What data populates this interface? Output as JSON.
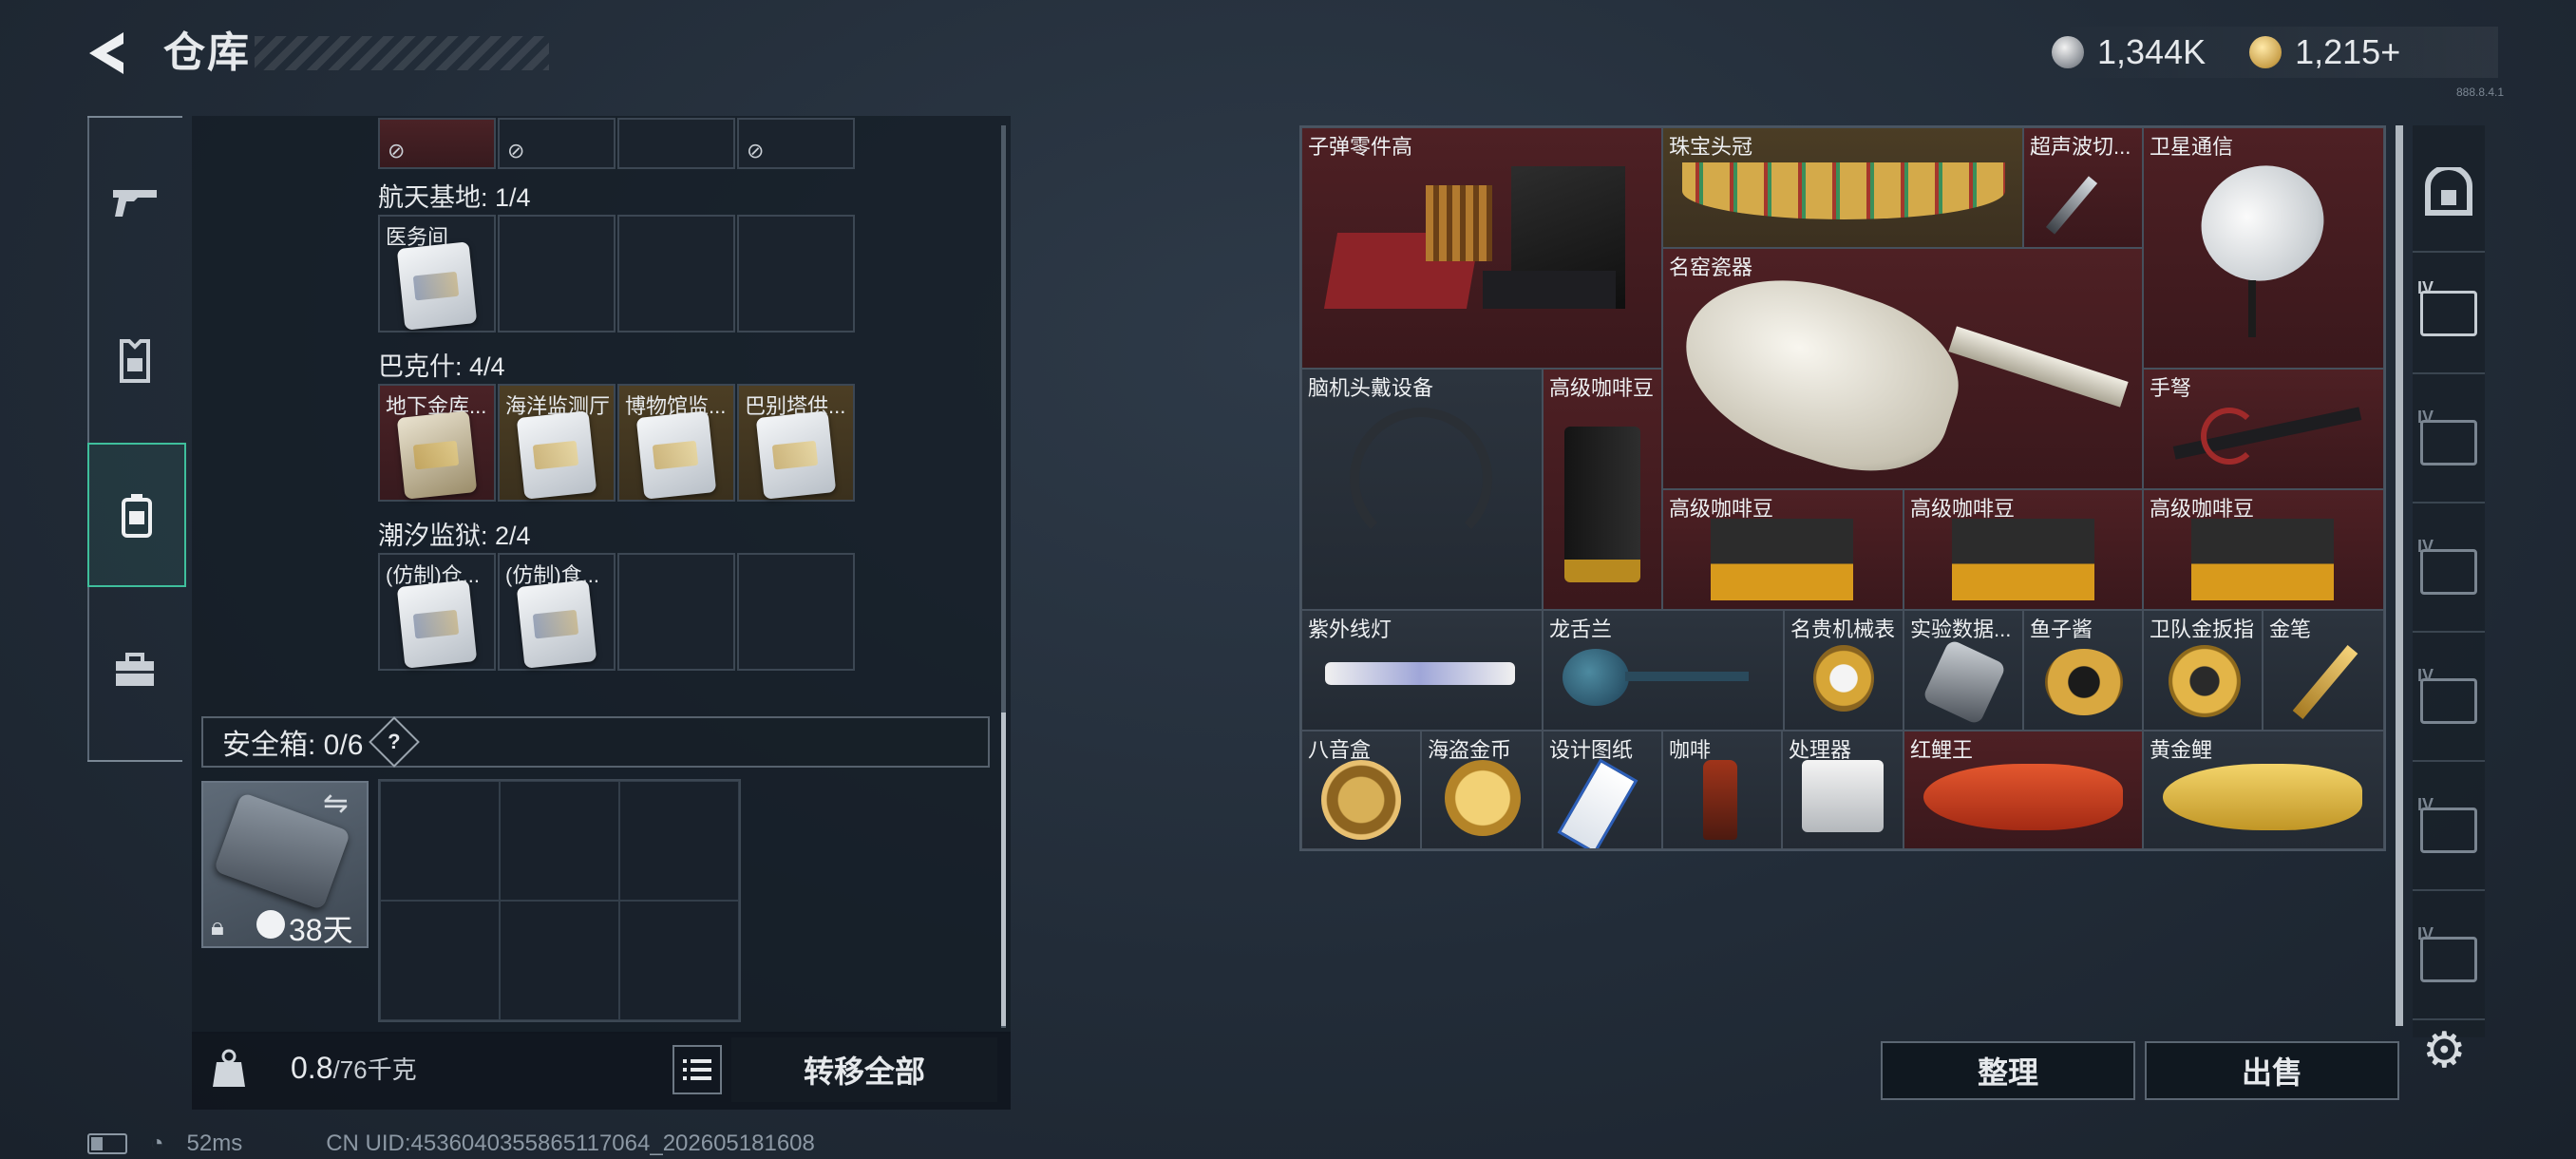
{
  "header": {
    "title": "仓库",
    "version": "888.8.4.1"
  },
  "currency": [
    {
      "icon": "silver-coin-icon",
      "value": "1,344K"
    },
    {
      "icon": "gold-coin-icon",
      "value": "1,215+"
    }
  ],
  "left_tabs": [
    {
      "name": "weapons",
      "icon": "gun-icon"
    },
    {
      "name": "armor",
      "icon": "armor-icon"
    },
    {
      "name": "backpack",
      "icon": "backpack-icon",
      "selected": true
    },
    {
      "name": "supplies",
      "icon": "toolbox-icon"
    }
  ],
  "sections": [
    {
      "title": "航天基地: 1/4",
      "items": [
        "医务间",
        "",
        "",
        ""
      ]
    },
    {
      "title": "巴克什: 4/4",
      "items": [
        "地下金库...",
        "海洋监测厅",
        "博物馆监...",
        "巴别塔供..."
      ]
    },
    {
      "title": "潮汐监狱: 2/4",
      "items": [
        "(仿制)仓...",
        "(仿制)食...",
        "",
        ""
      ]
    }
  ],
  "safe_box": {
    "label": "安全箱: 0/6",
    "help": "?",
    "days": "38天"
  },
  "weight": {
    "current": "0.8",
    "max": "/76千克"
  },
  "transfer_all": "转移全部",
  "stash_items": [
    {
      "name": "子弹零件高"
    },
    {
      "name": "珠宝头冠"
    },
    {
      "name": "超声波切..."
    },
    {
      "name": "卫星通信"
    },
    {
      "name": "名窑瓷器"
    },
    {
      "name": "脑机头戴设备"
    },
    {
      "name": "高级咖啡豆"
    },
    {
      "name": "手弩"
    },
    {
      "name": "高级咖啡豆"
    },
    {
      "name": "高级咖啡豆"
    },
    {
      "name": "高级咖啡豆"
    },
    {
      "name": "紫外线灯"
    },
    {
      "name": "龙舌兰"
    },
    {
      "name": "名贵机械表"
    },
    {
      "name": "实验数据..."
    },
    {
      "name": "鱼子酱"
    },
    {
      "name": "卫队金扳指"
    },
    {
      "name": "金笔"
    },
    {
      "name": "八音盒"
    },
    {
      "name": "海盗金币"
    },
    {
      "name": "设计图纸"
    },
    {
      "name": "咖啡"
    },
    {
      "name": "处理器"
    },
    {
      "name": "红鲤王"
    },
    {
      "name": "黄金鲤"
    }
  ],
  "right_tabs": [
    "IV",
    "IV",
    "IV",
    "IV",
    "IV",
    "IV"
  ],
  "buttons": {
    "sort": "整理",
    "sell": "出售"
  },
  "status": {
    "ping": "52ms",
    "uid": "CN UID:4536040355865117064_202605181608"
  }
}
